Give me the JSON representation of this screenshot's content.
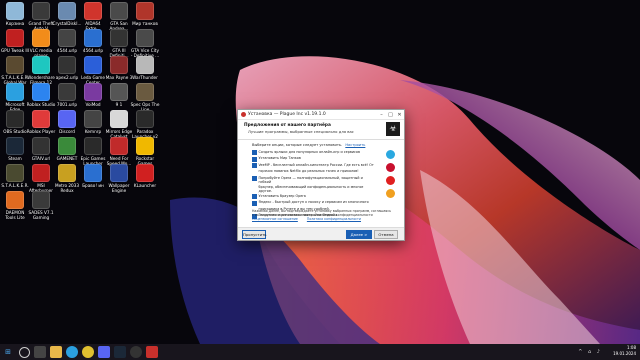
{
  "desktop_icons": [
    {
      "label": "Корзина",
      "color": "#8fb8d8"
    },
    {
      "label": "Grand Theft Auto V",
      "color": "#3a3a3a"
    },
    {
      "label": "CrystalDiskI...",
      "color": "#6a8ab0"
    },
    {
      "label": "AIDA64 Extre...",
      "color": "#d0342c"
    },
    {
      "label": "GTA San Andrea...",
      "color": "#4a4a4a"
    },
    {
      "label": "Мир танков",
      "color": "#b0352a"
    },
    {
      "label": "GPU Tweak III",
      "color": "#c02020"
    },
    {
      "label": "VLC media player",
      "color": "#f28c1a"
    },
    {
      "label": "4544.urlp",
      "color": "#444444"
    },
    {
      "label": "4564.urlp",
      "color": "#2a6fd0"
    },
    {
      "label": "GTA III Definiti...",
      "color": "#333333"
    },
    {
      "label": "GTA Vice City - Definitive ...",
      "color": "#4a4a4a"
    },
    {
      "label": "S.T.A.L.K.E.R. Global War",
      "color": "#5a4a30"
    },
    {
      "label": "Wondershare Filmora 12",
      "color": "#1ec7c0"
    },
    {
      "label": "apex2.urlp",
      "color": "#333333"
    },
    {
      "label": "Leda Game Center",
      "color": "#2b5fd9"
    },
    {
      "label": "Max Payne 3",
      "color": "#8a2a2a"
    },
    {
      "label": "WarThunder",
      "color": "#b8b8b8"
    },
    {
      "label": "Microsoft Edge",
      "color": "#2ba0e0"
    },
    {
      "label": "Roblox Studio",
      "color": "#2c84f0"
    },
    {
      "label": "7001.urlp",
      "color": "#3a3a3a"
    },
    {
      "label": "VoiMod",
      "color": "#7a3aa0"
    },
    {
      "label": "9 1",
      "color": "#555555"
    },
    {
      "label": "Spec Ops The Line",
      "color": "#6a5a40"
    },
    {
      "label": "OBS Studio",
      "color": "#2a2a2a"
    },
    {
      "label": "Roblox Player",
      "color": "#e03a3a"
    },
    {
      "label": "Discord",
      "color": "#5865f2"
    },
    {
      "label": "Kemnrp",
      "color": "#444444"
    },
    {
      "label": "Mirrors Edge Catalyst",
      "color": "#d8d8d8"
    },
    {
      "label": "Paradox Launcher v2",
      "color": "#2a2a2a"
    },
    {
      "label": "Steam",
      "color": "#1b2838"
    },
    {
      "label": "GTAIV.url",
      "color": "#333333"
    },
    {
      "label": "GAMENET",
      "color": "#3a8a3a"
    },
    {
      "label": "Epic Games Launcher",
      "color": "#2a2a2a"
    },
    {
      "label": "Need For Speed Mo...",
      "color": "#c02a2a"
    },
    {
      "label": "Rockstar Games Launcher",
      "color": "#f0b800"
    },
    {
      "label": "S.T.A.L.K.E.R.",
      "color": "#4a4a30"
    },
    {
      "label": "MSI Afterburner",
      "color": "#c02020"
    },
    {
      "label": "Metro 2033 Redux",
      "color": "#c8a020"
    },
    {
      "label": "Браво! ин",
      "color": "#2a6fd0"
    },
    {
      "label": "Wallpaper Engine",
      "color": "#2a4aa0"
    },
    {
      "label": "KLauncher",
      "color": "#d02020"
    },
    {
      "label": "DAEMON Tools Lite",
      "color": "#e06a20"
    },
    {
      "label": "SADES V7.1 Gaming",
      "color": "#3a3a3a"
    }
  ],
  "installer": {
    "window_title": "Установка — Plague Inc v1.19.1.0",
    "header_title": "Предложения от нашего партнёра",
    "header_subtitle": "Лучшие программы, выбранные специально для вас",
    "intro_text": "Выберите опции, которые следует установить.",
    "intro_link": "Настроить",
    "offers": [
      {
        "text": "Создать ярлыки для популярных онлайн-игр и сервисов",
        "checked": true
      },
      {
        "text": "Установить Мир Танков",
        "checked": true
      },
      {
        "text": "VeeMP - бесплатный онлайн-кинотеатр России. Где есть всё! От ",
        "checked": true
      },
      {
        "text": "горячих новинок Netflix до реальных тачек и приколов!",
        "checked": false
      },
      {
        "text": "Попробуйте Opera — полнофункциональный, защитный и гибкий ",
        "checked": true
      },
      {
        "text": "браузер, обеспечивающий конфиденциальность и многое другое.",
        "checked": false
      },
      {
        "text": "Установить браузер Opera",
        "checked": true
      },
      {
        "text": "Яндекс - быстрый доступ к поиску и сервисам из кнопочного ",
        "checked": true
      },
      {
        "text": "поисковика в Рунете и вы тем удобней.",
        "checked": false
      },
      {
        "text": "Загрузить и установить настройки Яндекса",
        "checked": true
      }
    ],
    "legal_text": "Нажимая Далее, Вы подтверждаете установку выбранных программ, соглашаясь с их лицензионными соглашениями и политикой конфиденциальности",
    "legal_link_1": "Лицензионное соглашение",
    "legal_link_2": "Политика конфиденциальности",
    "skip_label": "Пропустить",
    "next_label": "Далее >",
    "cancel_label": "Отмена",
    "side_icon_colors": [
      "#2aa8e0",
      "#c8102e",
      "#e02020",
      "#f0a020"
    ]
  },
  "taskbar": {
    "time": "1:08",
    "date": "19.01.2024",
    "apps": [
      "start",
      "search",
      "explorer",
      "edge",
      "chrome",
      "discord",
      "steam",
      "obs",
      "game"
    ]
  }
}
